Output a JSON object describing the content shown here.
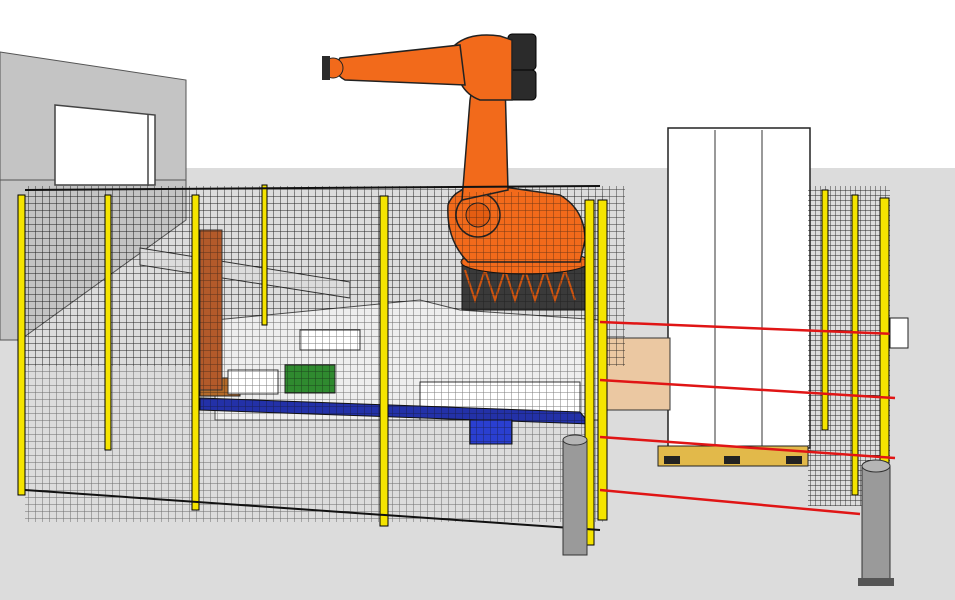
{
  "scene": {
    "colors": {
      "sky": "#ffffff",
      "ground": "#dcdcdc",
      "building": "#c8c8c8",
      "robot": "#f26a1b",
      "robot_dark": "#2b2b2b",
      "fence_post": "#f5e400",
      "mesh": "#111111",
      "light_curtain": "#e01515",
      "conveyor": "#2331a8",
      "green_tray": "#2f8a2f",
      "pallet_load": "#ffffff",
      "bollard": "#9a9a9a",
      "table_brown": "#e9c7a0"
    },
    "objects": [
      "building-wall",
      "industrial-robot-arm",
      "safety-fence",
      "light-curtain",
      "conveyor-station",
      "pallet-stack",
      "bollards"
    ]
  }
}
